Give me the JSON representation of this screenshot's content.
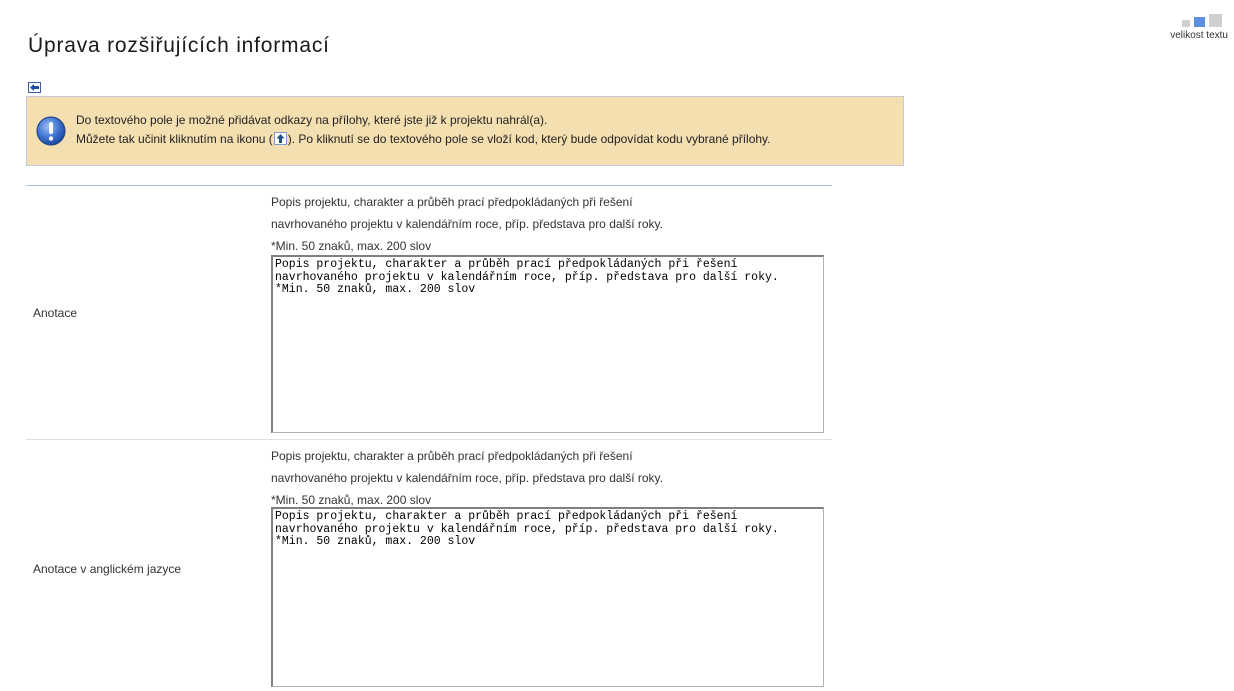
{
  "page_title": "Úprava rozšiřujících informací",
  "text_size": {
    "label": "velikost textu",
    "selected_color": "#5b8fe0"
  },
  "back_icon": "arrow-left-icon",
  "info": {
    "icon": "info-exclamation-icon",
    "line1": "Do textového pole je možné přidávat odkazy na přílohy, které jste již k projektu nahrál(a).",
    "line2_before": "Můžete tak učinit kliknutím na ikonu (",
    "line2_after": "). Po kliknutí se do textového pole se vloží kod, který bude odpovídat kodu vybrané přílohy.",
    "inline_icon": "arrow-up-icon",
    "background": "#f4dfb0"
  },
  "fields": [
    {
      "label": "Anotace",
      "hint_lines": [
        "Popis projektu, charakter a průběh prací předpokládaných při řešení",
        "navrhovaného projektu v kalendářním roce, příp. představa pro další roky.",
        "*Min. 50 znaků, max. 200 slov"
      ],
      "value": "Popis projektu, charakter a průběh prací předpokládaných při řešení navrhovaného projektu v kalendářním roce, příp. představa pro další roky.\n*Min. 50 znaků, max. 200 slov"
    },
    {
      "label": "Anotace v anglickém jazyce",
      "hint_lines": [
        "Popis projektu, charakter a průběh prací předpokládaných při řešení",
        "navrhovaného projektu v kalendářním roce, příp. představa pro další roky.",
        "*Min. 50 znaků, max. 200 slov"
      ],
      "value": "Popis projektu, charakter a průběh prací předpokládaných při řešení navrhovaného projektu v kalendářním roce, příp. představa pro další roky.\n*Min. 50 znaků, max. 200 slov"
    }
  ]
}
